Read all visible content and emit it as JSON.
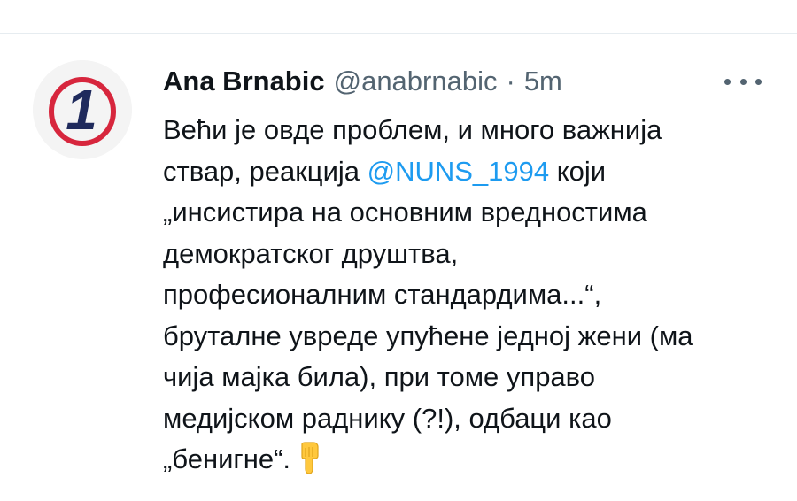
{
  "tweet": {
    "author": {
      "display_name": "Ana Brnabic",
      "handle": "@anabrnabic",
      "avatar_icon": "channel-1-logo-icon",
      "avatar_glyph": "1"
    },
    "separator": "·",
    "time": "5m",
    "more_icon": "more-options-icon",
    "body_lines": [
      {
        "text": "Већи је овде проблем, и много важнија"
      },
      {
        "before": "ствар, реакција ",
        "mention": "@NUNS_1994",
        "after": " који"
      },
      {
        "text": "„инсистира на основним вредностима"
      },
      {
        "text": "демократског друштва,"
      },
      {
        "text": "професионалним стандардима...“,"
      },
      {
        "text": "бруталне увреде упућене једној жени (ма"
      },
      {
        "text": "чија мајка била), при томе управо"
      },
      {
        "text": "медијском раднику (?!), одбаци као"
      },
      {
        "text": "„бенигне“."
      }
    ],
    "emoji": "backhand-index-pointing-down-icon"
  },
  "colors": {
    "text": "#0f1419",
    "secondary": "#536471",
    "link": "#1d9bf0",
    "avatar_red": "#d7263d",
    "avatar_navy": "#1f2a5c",
    "emoji_yellow": "#ffc83d"
  }
}
